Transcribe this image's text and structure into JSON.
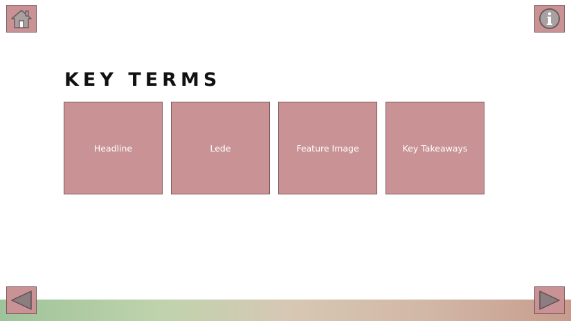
{
  "title": "KEY TERMS",
  "cards": [
    {
      "label": "Headline"
    },
    {
      "label": "Lede"
    },
    {
      "label": "Feature Image"
    },
    {
      "label": "Key Takeaways"
    }
  ],
  "icons": {
    "home": "home-icon",
    "info": "info-icon",
    "previous": "left-arrow-icon",
    "next": "right-arrow-icon"
  },
  "colors": {
    "button_fill": "#c99396",
    "button_border": "#7b5458",
    "icon": "#6b5a5c",
    "title": "#111111"
  }
}
